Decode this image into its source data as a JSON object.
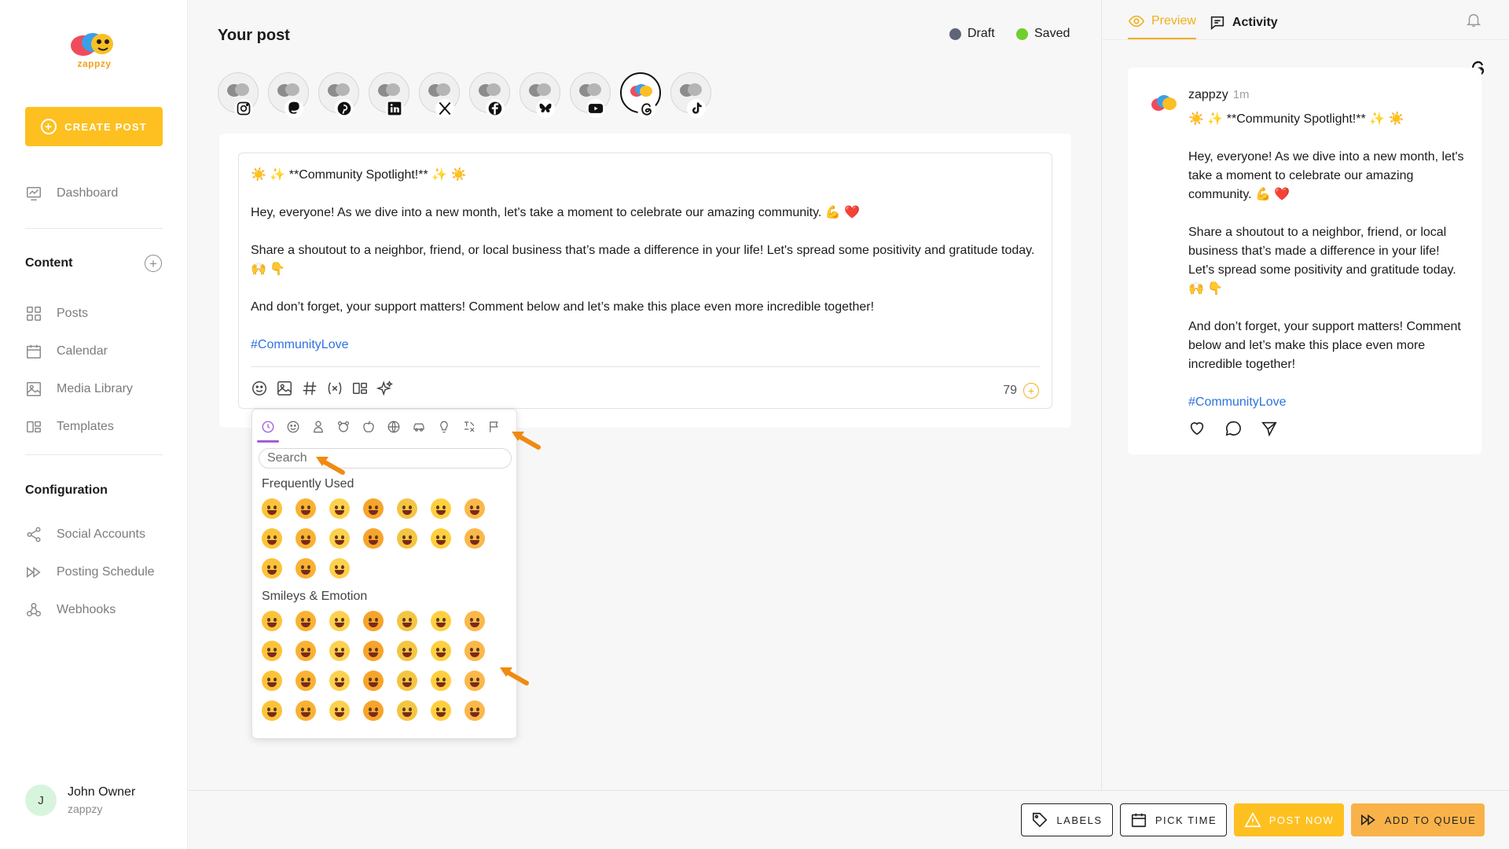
{
  "brand": {
    "logo_text": "zappzy"
  },
  "sidebar": {
    "create_label": "CREATE POST",
    "dashboard": "Dashboard",
    "content_title": "Content",
    "content_items": [
      "Posts",
      "Calendar",
      "Media Library",
      "Templates"
    ],
    "config_title": "Configuration",
    "config_items": [
      "Social Accounts",
      "Posting Schedule",
      "Webhooks"
    ]
  },
  "user": {
    "initial": "J",
    "name": "John Owner",
    "org": "zappzy"
  },
  "main": {
    "title": "Your post",
    "status_draft": "Draft",
    "status_saved": "Saved",
    "accounts": [
      "instagram",
      "mastodon",
      "pinterest",
      "linkedin",
      "x",
      "facebook",
      "bluesky",
      "youtube",
      "threads",
      "tiktok"
    ],
    "active_account": "threads"
  },
  "post": {
    "line1": "☀️ ✨ **Community Spotlight!** ✨ ☀️",
    "line2": "Hey, everyone! As we dive into a new month, let's take a moment to celebrate our amazing community. 💪 ❤️",
    "line3": "Share a shoutout to a neighbor, friend, or local business that’s made a difference in your life! Let's spread some positivity and gratitude today. 🙌 👇",
    "line4": "And don’t forget, your support matters! Comment below and let’s make this place even more incredible together!",
    "hashtag": "#CommunityLove",
    "char_count": "79"
  },
  "picker": {
    "search_placeholder": "Search",
    "section1": "Frequently Used",
    "section2": "Smileys & Emotion"
  },
  "preview": {
    "tab_preview": "Preview",
    "tab_activity": "Activity",
    "name": "zappzy",
    "time": "1m",
    "line1": "☀️ ✨ **Community Spotlight!** ✨ ☀️",
    "line2": "Hey, everyone! As we dive into a new month, let's take a moment to celebrate our amazing community. 💪 ❤️",
    "line3": "Share a shoutout to a neighbor, friend, or local business that’s made a difference in your life! Let's spread some positivity and gratitude today. 🙌 👇",
    "line4": "And don’t forget, your support matters! Comment below and let’s make this place even more incredible together!",
    "hashtag": "#CommunityLove"
  },
  "footer": {
    "labels": "LABELS",
    "pick_time": "PICK TIME",
    "post_now": "POST NOW",
    "add_queue": "ADD TO QUEUE"
  },
  "colors": {
    "accent": "#fdc020",
    "draft_dot": "#5d6577",
    "saved_dot": "#6fcf2c",
    "link": "#2f72e0",
    "tab_active": "#f2ae1c",
    "picker_active": "#a25fd6",
    "arrow": "#f08a12"
  }
}
